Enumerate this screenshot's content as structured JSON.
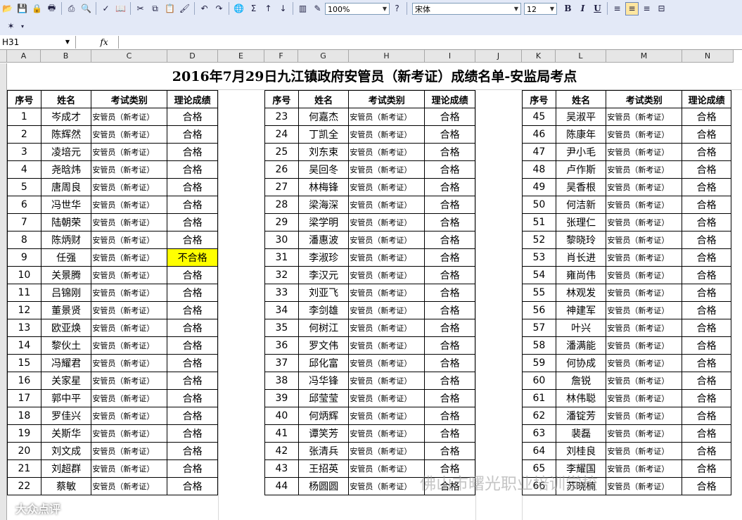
{
  "toolbar": {
    "zoom": "100%",
    "font_name": "宋体",
    "font_size": "12",
    "sum_symbol": "Σ",
    "bold": "B",
    "italic": "I",
    "underline": "U"
  },
  "formula_bar": {
    "name_box": "H31",
    "fx": "fx",
    "formula": ""
  },
  "columns": [
    "A",
    "B",
    "C",
    "D",
    "E",
    "F",
    "G",
    "H",
    "I",
    "J",
    "K",
    "L",
    "M",
    "N"
  ],
  "sheet": {
    "title": "2016年7月29日九江镇政府安管员（新考证）成绩名单-安监局考点",
    "headers": [
      "序号",
      "姓名",
      "考试类别",
      "理论成绩"
    ],
    "category": "安管员（新考证）",
    "pass": "合格",
    "fail": "不合格",
    "rows_left": [
      {
        "no": "1",
        "name": "岑成才",
        "result": "合格"
      },
      {
        "no": "2",
        "name": "陈辉然",
        "result": "合格"
      },
      {
        "no": "3",
        "name": "凌培元",
        "result": "合格"
      },
      {
        "no": "4",
        "name": "尧晗炜",
        "result": "合格"
      },
      {
        "no": "5",
        "name": "唐周良",
        "result": "合格"
      },
      {
        "no": "6",
        "name": "冯世华",
        "result": "合格"
      },
      {
        "no": "7",
        "name": "陆朝荣",
        "result": "合格"
      },
      {
        "no": "8",
        "name": "陈炳财",
        "result": "合格"
      },
      {
        "no": "9",
        "name": "任强",
        "result": "不合格"
      },
      {
        "no": "10",
        "name": "关景腾",
        "result": "合格"
      },
      {
        "no": "11",
        "name": "吕锦刚",
        "result": "合格"
      },
      {
        "no": "12",
        "name": "董景贤",
        "result": "合格"
      },
      {
        "no": "13",
        "name": "欧亚焕",
        "result": "合格"
      },
      {
        "no": "14",
        "name": "黎伙土",
        "result": "合格"
      },
      {
        "no": "15",
        "name": "冯耀君",
        "result": "合格"
      },
      {
        "no": "16",
        "name": "关家星",
        "result": "合格"
      },
      {
        "no": "17",
        "name": "郭中平",
        "result": "合格"
      },
      {
        "no": "18",
        "name": "罗佳兴",
        "result": "合格"
      },
      {
        "no": "19",
        "name": "关斯华",
        "result": "合格"
      },
      {
        "no": "20",
        "name": "刘文成",
        "result": "合格"
      },
      {
        "no": "21",
        "name": "刘超群",
        "result": "合格"
      },
      {
        "no": "22",
        "name": "蔡敏",
        "result": "合格"
      }
    ],
    "rows_mid": [
      {
        "no": "23",
        "name": "何嘉杰",
        "result": "合格"
      },
      {
        "no": "24",
        "name": "丁凯全",
        "result": "合格"
      },
      {
        "no": "25",
        "name": "刘东束",
        "result": "合格"
      },
      {
        "no": "26",
        "name": "吴回冬",
        "result": "合格"
      },
      {
        "no": "27",
        "name": "林梅锋",
        "result": "合格"
      },
      {
        "no": "28",
        "name": "梁海深",
        "result": "合格"
      },
      {
        "no": "29",
        "name": "梁学明",
        "result": "合格"
      },
      {
        "no": "30",
        "name": "潘惠波",
        "result": "合格"
      },
      {
        "no": "31",
        "name": "李淑珍",
        "result": "合格"
      },
      {
        "no": "32",
        "name": "李汉元",
        "result": "合格"
      },
      {
        "no": "33",
        "name": "刘亚飞",
        "result": "合格"
      },
      {
        "no": "34",
        "name": "李剑雄",
        "result": "合格"
      },
      {
        "no": "35",
        "name": "何树江",
        "result": "合格"
      },
      {
        "no": "36",
        "name": "罗文伟",
        "result": "合格"
      },
      {
        "no": "37",
        "name": "邱化富",
        "result": "合格"
      },
      {
        "no": "38",
        "name": "冯华锋",
        "result": "合格"
      },
      {
        "no": "39",
        "name": "邱莹莹",
        "result": "合格"
      },
      {
        "no": "40",
        "name": "何炳辉",
        "result": "合格"
      },
      {
        "no": "41",
        "name": "谭笑芳",
        "result": "合格"
      },
      {
        "no": "42",
        "name": "张清兵",
        "result": "合格"
      },
      {
        "no": "43",
        "name": "王招英",
        "result": "合格"
      },
      {
        "no": "44",
        "name": "杨圆圆",
        "result": "合格"
      }
    ],
    "rows_right": [
      {
        "no": "45",
        "name": "吴淑平",
        "result": "合格"
      },
      {
        "no": "46",
        "name": "陈康年",
        "result": "合格"
      },
      {
        "no": "47",
        "name": "尹小毛",
        "result": "合格"
      },
      {
        "no": "48",
        "name": "卢作斯",
        "result": "合格"
      },
      {
        "no": "49",
        "name": "吴香根",
        "result": "合格"
      },
      {
        "no": "50",
        "name": "何洁新",
        "result": "合格"
      },
      {
        "no": "51",
        "name": "张理仁",
        "result": "合格"
      },
      {
        "no": "52",
        "name": "黎晓玲",
        "result": "合格"
      },
      {
        "no": "53",
        "name": "肖长进",
        "result": "合格"
      },
      {
        "no": "54",
        "name": "雍尚伟",
        "result": "合格"
      },
      {
        "no": "55",
        "name": "林观发",
        "result": "合格"
      },
      {
        "no": "56",
        "name": "神建军",
        "result": "合格"
      },
      {
        "no": "57",
        "name": "叶兴",
        "result": "合格"
      },
      {
        "no": "58",
        "name": "潘满能",
        "result": "合格"
      },
      {
        "no": "59",
        "name": "何协成",
        "result": "合格"
      },
      {
        "no": "60",
        "name": "詹锐",
        "result": "合格"
      },
      {
        "no": "61",
        "name": "林伟聪",
        "result": "合格"
      },
      {
        "no": "62",
        "name": "潘锭芳",
        "result": "合格"
      },
      {
        "no": "63",
        "name": "裴磊",
        "result": "合格"
      },
      {
        "no": "64",
        "name": "刘桂良",
        "result": "合格"
      },
      {
        "no": "65",
        "name": "李耀国",
        "result": "合格"
      },
      {
        "no": "66",
        "name": "苏晓楠",
        "result": "合格"
      }
    ]
  },
  "watermarks": {
    "wechat": "佛山市曙光职业培训学校",
    "corner": "大众点评"
  }
}
